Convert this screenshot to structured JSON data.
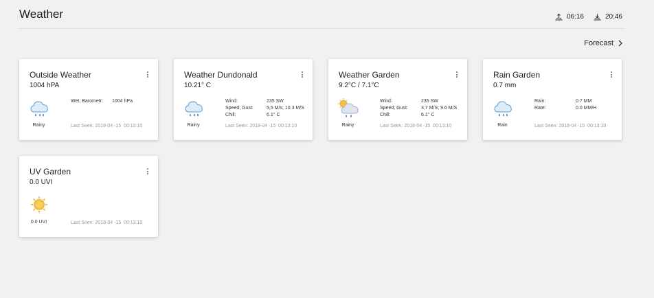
{
  "header": {
    "title": "Weather",
    "sunrise_icon": "sunrise-icon",
    "sunrise": "06:16",
    "sunset_icon": "sunset-icon",
    "sunset": "20:46"
  },
  "forecast": {
    "label": "Forecast",
    "icon": "chevron-right-icon"
  },
  "cards": [
    {
      "name": "Outside Weather",
      "value": "1004 hPA",
      "icon": "rain-cloud-icon",
      "condition": "Rainy",
      "details": [
        {
          "label": "Wet, Barometr:",
          "value": "1004 hPa"
        }
      ],
      "last_seen": "Last Seen: 2018-04 -15  00:13:10"
    },
    {
      "name": "Weather Dundonald",
      "value": "10.21° C",
      "icon": "rain-cloud-icon",
      "condition": "Rainy",
      "details": [
        {
          "label": "Wind:",
          "value": "235 SW"
        },
        {
          "label": "Speed; Gust:",
          "value": "5,5 M/s; 10.3 M/S"
        },
        {
          "label": "Chill:",
          "value": "6.1° C"
        }
      ],
      "last_seen": "Last Seen: 2018-04 -15  00:13:10"
    },
    {
      "name": "Weather Garden",
      "value": "9.2°C /  7.1°C",
      "icon": "sun-rain-cloud-icon",
      "condition": "Rainy",
      "details": [
        {
          "label": "Wind:",
          "value": "235 SW"
        },
        {
          "label": "Speed; Gust:",
          "value": "3.7 M/S; 9.6 M/S"
        },
        {
          "label": "Chill:",
          "value": "6.1° C"
        }
      ],
      "last_seen": "Last Seen: 2018-04 -15  00:13:10"
    },
    {
      "name": "Rain Garden",
      "value": "0.7 mm",
      "icon": "rain-cloud-icon",
      "condition": "Rain",
      "details": [
        {
          "label": "Rain:",
          "value": "0.7 MM"
        },
        {
          "label": "Rate:",
          "value": "0.0 MM/H"
        }
      ],
      "last_seen": "Last Seen: 2018-04 -15  00:13:10"
    },
    {
      "name": "UV Garden",
      "value": "0.0 UVI",
      "icon": "sun-icon",
      "condition": "0.0 UVI",
      "details": [],
      "last_seen": "Last Seen: 2018-04 -15  00:13:10"
    }
  ],
  "colors": {
    "background": "#f1f1f1",
    "card": "#ffffff",
    "cloud_fill": "#dcecf8",
    "cloud_stroke": "#5b9bd5",
    "rain": "#4a86c5",
    "sun": "#f5c244"
  }
}
